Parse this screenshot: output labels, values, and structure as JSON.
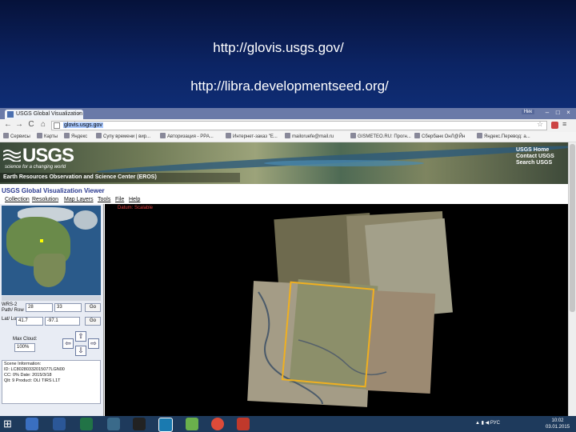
{
  "slide": {
    "line1": "http://glovis.usgs.gov/",
    "line2": "http://libra.developmentseed.org/"
  },
  "browser": {
    "tab_title": "USGS Global Visualization",
    "tab_close": "×",
    "user_badge": "Ник",
    "window_controls": [
      "–",
      "□",
      "×"
    ],
    "nav": [
      "←",
      "→",
      "C",
      "⌂"
    ],
    "address": "glovis.usgs.gov",
    "bookmarks": [
      "Сервисы",
      "Карты",
      "Яндекс",
      "Супу времени | вир...",
      "Авторизация - РРА...",
      "Интернет-заказ \"Е...",
      "mailoruefe@mail.ru",
      "GISMETEO.RU: Прогн...",
      "Сбербанк ОнЛ@Йн",
      "Яндекс.Перевод: а..."
    ]
  },
  "usgs": {
    "logo": "USGS",
    "tagline": "science for a changing world",
    "eros": "Earth Resources Observation and Science Center (EROS)",
    "toplinks": [
      "USGS Home",
      "Contact USGS",
      "Search USGS"
    ],
    "viewer_title": "USGS Global Visualization Viewer",
    "menu": [
      "Collection",
      "Resolution",
      "Map Layers",
      "Tools",
      "File",
      "Help"
    ],
    "map_title": "Datum: Scalable",
    "wrs_label": "WRS-2",
    "path_row_label": "Path/ Row",
    "path": "28",
    "row": "33",
    "go": "Go",
    "lat_long_label": "Lat/ Long",
    "lat": "41.7",
    "long": "-97.1",
    "max_cloud_label": "Max Cloud:",
    "max_cloud": "100%",
    "scene_info_title": "Scene Information:",
    "scene_info": [
      "ID: LC80280332015077LGN00",
      "CC: 0%    Date: 2015/3/18",
      "Qlt: 9  Product: OLI TIRS L1T"
    ]
  },
  "taskbar": {
    "lang": "РУС",
    "time": "10:02",
    "date": "03.01.2015"
  },
  "colors": {
    "slide_bg": "#0c2464",
    "selection": "#f0b020",
    "taskbar": "#1e3a5c"
  }
}
